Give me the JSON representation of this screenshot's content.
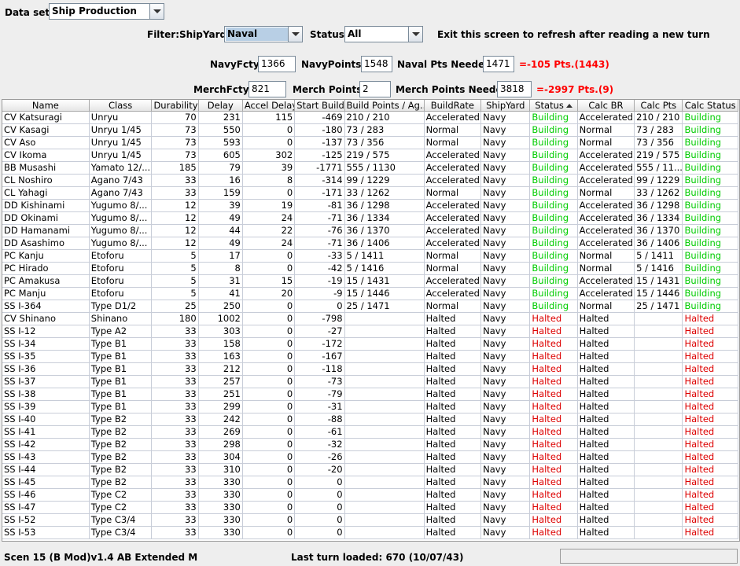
{
  "top": {
    "dataset_label": "Data set:",
    "dataset_value": "Ship Production",
    "filter_label": "Filter:",
    "shipyard_label": "ShipYard:",
    "shipyard_value": "Naval",
    "status_label": "Status:",
    "status_value": "All",
    "refresh_note": "Exit this screen to refresh after reading a new turn"
  },
  "navy": {
    "fcty_label": "NavyFcty:",
    "fcty_value": "1366",
    "points_label": "NavyPoints:",
    "points_value": "1548",
    "needed_label": "Naval Pts Needed:",
    "needed_value": "1471",
    "diff": "=-105 Pts.(1443)"
  },
  "merch": {
    "fcty_label": "MerchFcty:",
    "fcty_value": "821",
    "points_label": "Merch Points:",
    "points_value": "2",
    "needed_label": "Merch Points Needed:",
    "needed_value": "3818",
    "diff": "=-2997 Pts.(9)"
  },
  "table": {
    "headers": [
      "Name",
      "Class",
      "Durability",
      "Delay",
      "Accel Delay",
      "Start Buildi...",
      "Build Points / Ag...",
      "BuildRate",
      "ShipYard",
      "Status",
      "Calc BR",
      "Calc Pts",
      "Calc Status"
    ],
    "rows": [
      [
        "CV Katsuragi",
        "Unryu",
        "70",
        "231",
        "115",
        "-469",
        "210 / 210",
        "Accelerated",
        "Navy",
        "Building",
        "Accelerated",
        "210 / 210",
        "Building"
      ],
      [
        "CV Kasagi",
        "Unryu 1/45",
        "73",
        "550",
        "0",
        "-180",
        "73 / 283",
        "Normal",
        "Navy",
        "Building",
        "Normal",
        "73 / 283",
        "Building"
      ],
      [
        "CV Aso",
        "Unryu 1/45",
        "73",
        "593",
        "0",
        "-137",
        "73 / 356",
        "Normal",
        "Navy",
        "Building",
        "Normal",
        "73 / 356",
        "Building"
      ],
      [
        "CV Ikoma",
        "Unryu 1/45",
        "73",
        "605",
        "302",
        "-125",
        "219 / 575",
        "Accelerated",
        "Navy",
        "Building",
        "Accelerated",
        "219 / 575",
        "Building"
      ],
      [
        "BB Musashi",
        "Yamato 12/...",
        "185",
        "79",
        "39",
        "-1771",
        "555 / 1130",
        "Accelerated",
        "Navy",
        "Building",
        "Accelerated",
        "555 / 11...",
        "Building"
      ],
      [
        "CL Noshiro",
        "Agano 7/43",
        "33",
        "16",
        "8",
        "-314",
        "99 / 1229",
        "Accelerated",
        "Navy",
        "Building",
        "Accelerated",
        "99 / 1229",
        "Building"
      ],
      [
        "CL Yahagi",
        "Agano 7/43",
        "33",
        "159",
        "0",
        "-171",
        "33 / 1262",
        "Normal",
        "Navy",
        "Building",
        "Normal",
        "33 / 1262",
        "Building"
      ],
      [
        "DD Kishinami",
        "Yugumo 8/...",
        "12",
        "39",
        "19",
        "-81",
        "36 / 1298",
        "Accelerated",
        "Navy",
        "Building",
        "Accelerated",
        "36 / 1298",
        "Building"
      ],
      [
        "DD Okinami",
        "Yugumo 8/...",
        "12",
        "49",
        "24",
        "-71",
        "36 / 1334",
        "Accelerated",
        "Navy",
        "Building",
        "Accelerated",
        "36 / 1334",
        "Building"
      ],
      [
        "DD Hamanami",
        "Yugumo 8/...",
        "12",
        "44",
        "22",
        "-76",
        "36 / 1370",
        "Accelerated",
        "Navy",
        "Building",
        "Accelerated",
        "36 / 1370",
        "Building"
      ],
      [
        "DD Asashimo",
        "Yugumo 8/...",
        "12",
        "49",
        "24",
        "-71",
        "36 / 1406",
        "Accelerated",
        "Navy",
        "Building",
        "Accelerated",
        "36 / 1406",
        "Building"
      ],
      [
        "PC Kanju",
        "Etoforu",
        "5",
        "17",
        "0",
        "-33",
        "5 / 1411",
        "Normal",
        "Navy",
        "Building",
        "Normal",
        "5 / 1411",
        "Building"
      ],
      [
        "PC Hirado",
        "Etoforu",
        "5",
        "8",
        "0",
        "-42",
        "5 / 1416",
        "Normal",
        "Navy",
        "Building",
        "Normal",
        "5 / 1416",
        "Building"
      ],
      [
        "PC Amakusa",
        "Etoforu",
        "5",
        "31",
        "15",
        "-19",
        "15 / 1431",
        "Accelerated",
        "Navy",
        "Building",
        "Accelerated",
        "15 / 1431",
        "Building"
      ],
      [
        "PC Manju",
        "Etoforu",
        "5",
        "41",
        "20",
        "-9",
        "15 / 1446",
        "Accelerated",
        "Navy",
        "Building",
        "Accelerated",
        "15 / 1446",
        "Building"
      ],
      [
        "SS I-364",
        "Type D1/2",
        "25",
        "250",
        "0",
        "0",
        "25 / 1471",
        "Normal",
        "Navy",
        "Building",
        "Normal",
        "25 / 1471",
        "Building"
      ],
      [
        "CV Shinano",
        "Shinano",
        "180",
        "1002",
        "0",
        "-798",
        "",
        "Halted",
        "Navy",
        "Halted",
        "Halted",
        "",
        "Halted"
      ],
      [
        "SS I-12",
        "Type A2",
        "33",
        "303",
        "0",
        "-27",
        "",
        "Halted",
        "Navy",
        "Halted",
        "Halted",
        "",
        "Halted"
      ],
      [
        "SS I-34",
        "Type B1",
        "33",
        "158",
        "0",
        "-172",
        "",
        "Halted",
        "Navy",
        "Halted",
        "Halted",
        "",
        "Halted"
      ],
      [
        "SS I-35",
        "Type B1",
        "33",
        "163",
        "0",
        "-167",
        "",
        "Halted",
        "Navy",
        "Halted",
        "Halted",
        "",
        "Halted"
      ],
      [
        "SS I-36",
        "Type B1",
        "33",
        "212",
        "0",
        "-118",
        "",
        "Halted",
        "Navy",
        "Halted",
        "Halted",
        "",
        "Halted"
      ],
      [
        "SS I-37",
        "Type B1",
        "33",
        "257",
        "0",
        "-73",
        "",
        "Halted",
        "Navy",
        "Halted",
        "Halted",
        "",
        "Halted"
      ],
      [
        "SS I-38",
        "Type B1",
        "33",
        "251",
        "0",
        "-79",
        "",
        "Halted",
        "Navy",
        "Halted",
        "Halted",
        "",
        "Halted"
      ],
      [
        "SS I-39",
        "Type B1",
        "33",
        "299",
        "0",
        "-31",
        "",
        "Halted",
        "Navy",
        "Halted",
        "Halted",
        "",
        "Halted"
      ],
      [
        "SS I-40",
        "Type B2",
        "33",
        "242",
        "0",
        "-88",
        "",
        "Halted",
        "Navy",
        "Halted",
        "Halted",
        "",
        "Halted"
      ],
      [
        "SS I-41",
        "Type B2",
        "33",
        "269",
        "0",
        "-61",
        "",
        "Halted",
        "Navy",
        "Halted",
        "Halted",
        "",
        "Halted"
      ],
      [
        "SS I-42",
        "Type B2",
        "33",
        "298",
        "0",
        "-32",
        "",
        "Halted",
        "Navy",
        "Halted",
        "Halted",
        "",
        "Halted"
      ],
      [
        "SS I-43",
        "Type B2",
        "33",
        "304",
        "0",
        "-26",
        "",
        "Halted",
        "Navy",
        "Halted",
        "Halted",
        "",
        "Halted"
      ],
      [
        "SS I-44",
        "Type B2",
        "33",
        "310",
        "0",
        "-20",
        "",
        "Halted",
        "Navy",
        "Halted",
        "Halted",
        "",
        "Halted"
      ],
      [
        "SS I-45",
        "Type B2",
        "33",
        "330",
        "0",
        "0",
        "",
        "Halted",
        "Navy",
        "Halted",
        "Halted",
        "",
        "Halted"
      ],
      [
        "SS I-46",
        "Type C2",
        "33",
        "330",
        "0",
        "0",
        "",
        "Halted",
        "Navy",
        "Halted",
        "Halted",
        "",
        "Halted"
      ],
      [
        "SS I-47",
        "Type C2",
        "33",
        "330",
        "0",
        "0",
        "",
        "Halted",
        "Navy",
        "Halted",
        "Halted",
        "",
        "Halted"
      ],
      [
        "SS I-52",
        "Type C3/4",
        "33",
        "330",
        "0",
        "0",
        "",
        "Halted",
        "Navy",
        "Halted",
        "Halted",
        "",
        "Halted"
      ],
      [
        "SS I-53",
        "Type C3/4",
        "33",
        "330",
        "0",
        "0",
        "",
        "Halted",
        "Navy",
        "Halted",
        "Halted",
        "",
        "Halted"
      ]
    ]
  },
  "statusbar": {
    "scenario": "Scen 15 (B Mod)v1.4 AB Extended M",
    "last_turn": "Last turn loaded: 670 (10/07/43)"
  },
  "colors": {
    "building": "#00cc00",
    "halted": "#dd0000",
    "deficit": "#ff0000"
  }
}
